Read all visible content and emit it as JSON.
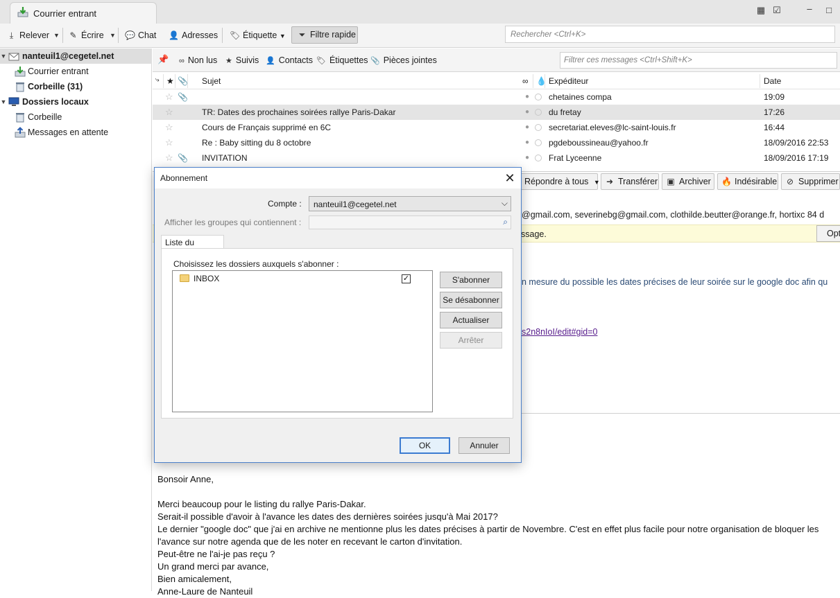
{
  "window": {
    "tab_label": "Courrier entrant",
    "colors": {
      "toolbar_bg": "#f4f4f4",
      "selection": "#dedede",
      "dialog_border": "#4a7fc9",
      "link": "#551a8b"
    }
  },
  "toolbar": {
    "relever": "Relever",
    "ecrire": "Écrire",
    "chat": "Chat",
    "adresses": "Adresses",
    "etiquette": "Étiquette",
    "filtre_rapide": "Filtre rapide",
    "search_placeholder": "Rechercher <Ctrl+K>"
  },
  "folders": {
    "account": "nanteuil1@cegetel.net",
    "inbox": "Courrier entrant",
    "trash": "Corbeille (31)",
    "local": "Dossiers locaux",
    "local_trash": "Corbeille",
    "outbox": "Messages en attente"
  },
  "quickfilter": {
    "non_lus": "Non lus",
    "suivis": "Suivis",
    "contacts": "Contacts",
    "etiquettes": "Étiquettes",
    "pieces_jointes": "Pièces jointes",
    "filter_placeholder": "Filtrer ces messages <Ctrl+Shift+K>"
  },
  "thread": {
    "columns": {
      "subject": "Sujet",
      "sender": "Expéditeur",
      "date": "Date"
    },
    "messages": [
      {
        "subject": "",
        "sender": "chetaines compa",
        "date": "19:09"
      },
      {
        "subject": "TR: Dates des prochaines soirées rallye Paris-Dakar",
        "sender": "du fretay",
        "date": "17:26"
      },
      {
        "subject": "Cours de Français supprimé en 6C",
        "sender": "secretariat.eleves@lc-saint-louis.fr",
        "date": "16:44"
      },
      {
        "subject": "Re : Baby sitting du 8 octobre",
        "sender": "pgdeboussineau@yahoo.fr",
        "date": "18/09/2016 22:53"
      },
      {
        "subject": "INVITATION",
        "sender": "Frat Lyceenne",
        "date": "18/09/2016 17:19"
      }
    ]
  },
  "header_buttons": {
    "repondre_tous": "Répondre à tous",
    "transferer": "Transférer",
    "archiver": "Archiver",
    "indesirable": "Indésirable",
    "supprimer": "Supprimer"
  },
  "message": {
    "recipients": "@gmail.com, severinebg@gmail.com, clothilde.beutter@orange.fr, hortixc 84 d",
    "notice": "ssage.",
    "options_button": "Opt",
    "body_partial": "n mesure du possible les dates précises de leur soirée sur le google doc  afin qu",
    "link": "s2n8nIoI/edit#gid=0",
    "body_lines": [
      "Bonsoir Anne,",
      "",
      "Merci beaucoup pour le listing du rallye Paris-Dakar.",
      "Serait-il possible d'avoir à l'avance les dates des dernières soirées jusqu'à Mai 2017?",
      "Le dernier \"google doc\" que j'ai en archive ne mentionne plus les dates précises à partir de Novembre. C'est en effet plus facile pour notre organisation de bloquer les",
      "l'avance sur notre agenda que de les noter en recevant le carton d'invitation.",
      "Peut-être ne l'ai-je pas reçu ?",
      "Un grand merci par avance,",
      "Bien amicalement,",
      "Anne-Laure de Nanteuil"
    ]
  },
  "dialog": {
    "title": "Abonnement",
    "compte_label": "Compte :",
    "compte_value": "nanteuil1@cegetel.net",
    "filter_label": "Afficher les groupes qui contiennent :",
    "tab_label": "Liste du dossier",
    "list_label": "Choisissez les dossiers auxquels s'abonner :",
    "folder_name": "INBOX",
    "folder_checked": true,
    "btn_subscribe": "S'abonner",
    "btn_unsubscribe": "Se désabonner",
    "btn_refresh": "Actualiser",
    "btn_stop": "Arrêter",
    "btn_ok": "OK",
    "btn_cancel": "Annuler"
  }
}
